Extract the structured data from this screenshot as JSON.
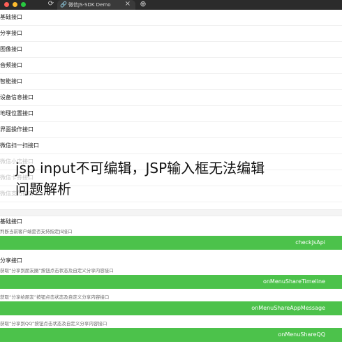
{
  "browser": {
    "tab_title": "微信JS-SDK Demo",
    "tab_close": "×",
    "new_tab": "⊕",
    "refresh": "⟳",
    "favicon": "🔗"
  },
  "menu": {
    "items": [
      {
        "label": "基础接口"
      },
      {
        "label": "分享接口"
      },
      {
        "label": "图像接口"
      },
      {
        "label": "音频接口"
      },
      {
        "label": "智能接口"
      },
      {
        "label": "设备信息接口"
      },
      {
        "label": "地理位置接口"
      },
      {
        "label": "界面操作接口"
      },
      {
        "label": "微信扫一扫接口"
      },
      {
        "label": "微信小店接口"
      },
      {
        "label": "微信卡券接口"
      },
      {
        "label": "微信支付接口"
      }
    ]
  },
  "overlay": {
    "line1": "jsp input不可编辑，JSP输入框无法编辑",
    "line2": "问题解析"
  },
  "sections": [
    {
      "title": "基础接口",
      "desc": "判断当前客户端是否支持指定JS接口",
      "button": "checkJsApi"
    },
    {
      "title": "分享接口",
      "entries": [
        {
          "desc": "获取“分享到朋友圈”按钮点击状态及自定义分享内容接口",
          "button": "onMenuShareTimeline"
        },
        {
          "desc": "获取“分享给朋友”按钮点击状态及自定义分享内容接口",
          "button": "onMenuShareAppMessage"
        },
        {
          "desc": "获取“分享到QQ”按钮点击状态及自定义分享内容接口",
          "button": "onMenuShareQQ"
        }
      ]
    }
  ],
  "colors": {
    "green_button": "#4cc24b"
  }
}
